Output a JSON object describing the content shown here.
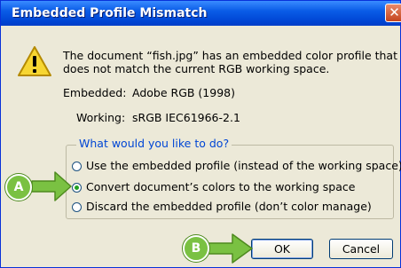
{
  "dialog": {
    "title": "Embedded Profile Mismatch",
    "close_glyph": "✕",
    "message_line1": "The document “fish.jpg” has an embedded color profile that",
    "message_line2": "does not match the current RGB working space.",
    "embedded_label": "Embedded:",
    "embedded_value": "Adobe RGB (1998)",
    "working_label": "Working:",
    "working_value": "sRGB IEC61966-2.1",
    "group_title": "What would you like to do?",
    "options": [
      {
        "label": "Use the embedded profile (instead of the working space)",
        "selected": false
      },
      {
        "label": "Convert document’s colors to the working space",
        "selected": true
      },
      {
        "label": "Discard the embedded profile (don’t color manage)",
        "selected": false
      }
    ],
    "ok_label": "OK",
    "cancel_label": "Cancel"
  },
  "callouts": {
    "a_label": "A",
    "b_label": "B",
    "color": "#7ac142"
  },
  "icons": {
    "warning": "warning-triangle-icon",
    "close": "close-icon"
  }
}
